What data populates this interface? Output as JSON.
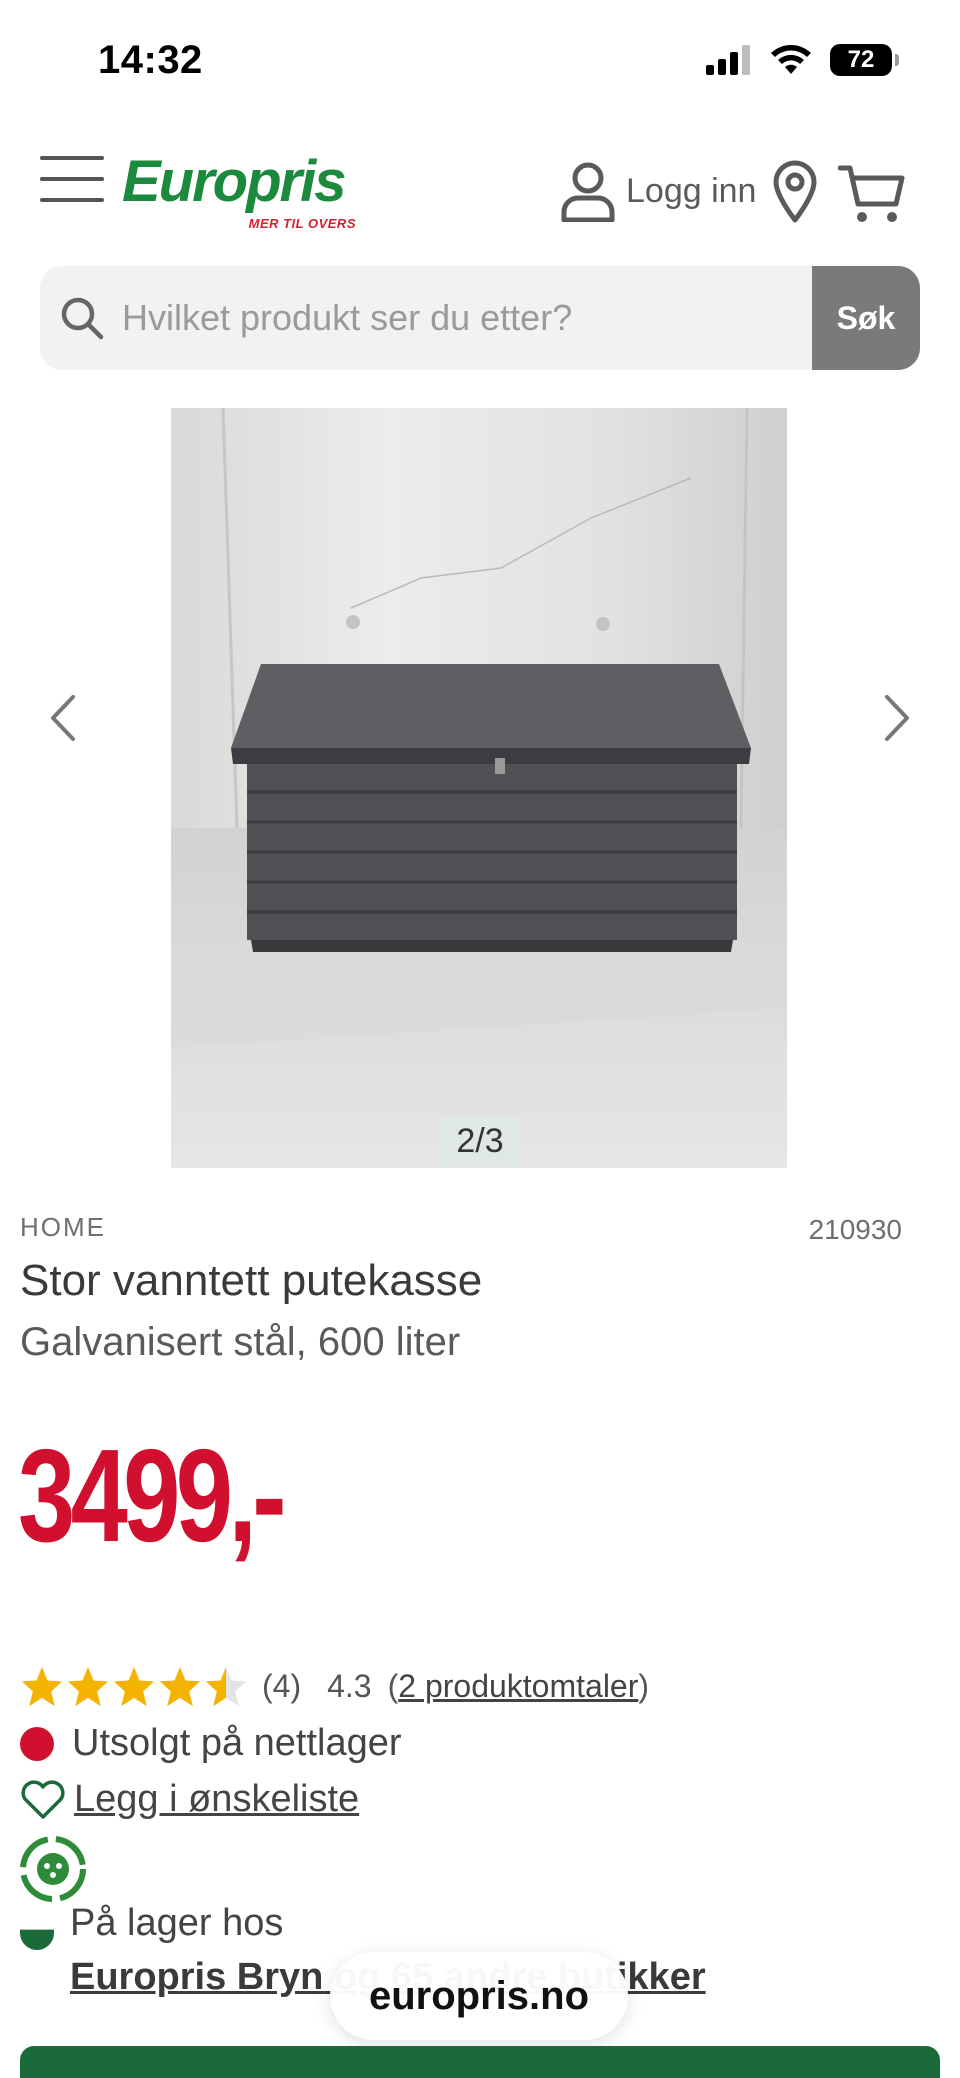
{
  "status_bar": {
    "time": "14:32",
    "battery": "72",
    "icons": [
      "cellular-signal-icon",
      "wifi-icon",
      "battery-icon"
    ]
  },
  "header": {
    "logo_text": "Europris",
    "logo_tagline": "MER TIL OVERS",
    "login_label": "Logg inn",
    "icons": [
      "menu-icon",
      "user-icon",
      "location-icon",
      "cart-icon"
    ]
  },
  "search": {
    "placeholder": "Hvilket produkt ser du etter?",
    "button_label": "Søk"
  },
  "gallery": {
    "counter": "2/3",
    "current_index": 2,
    "total": 3
  },
  "product": {
    "brand": "HOME",
    "sku": "210930",
    "title": "Stor vanntett putekasse",
    "subtitle": "Galvanisert stål, 600 liter",
    "price": "3499,-"
  },
  "rating": {
    "stars_value": 4.3,
    "count_label": "(4)",
    "value_label": "4.3",
    "reviews_label": "2 produktomtaler",
    "paren_open": "(",
    "paren_close": ")"
  },
  "availability": {
    "online_status": "Utsolgt på nettlager",
    "wishlist_label": "Legg i ønskeliste",
    "store_label": "På lager hos",
    "store_name": "Europris Bryn",
    "store_suffix": " og 65 andre butikker",
    "store_suffix_prefix": " o",
    "store_suffix_visible_end": "ker"
  },
  "browser": {
    "url": "europris.no"
  },
  "colors": {
    "brand_green": "#1b8a3c",
    "price_red": "#d0102e",
    "star_yellow": "#f5b301",
    "dark_green": "#1b6b3a"
  }
}
